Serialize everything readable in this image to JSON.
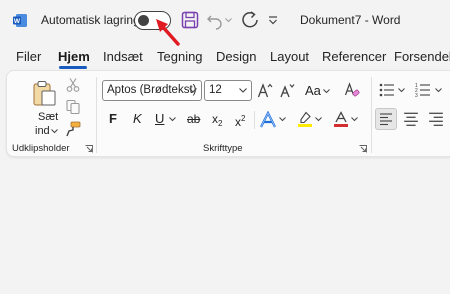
{
  "titlebar": {
    "autosave_label": "Automatisk lagring",
    "document_title": "Dokument7  -  Word"
  },
  "tabs": [
    {
      "label": "Filer"
    },
    {
      "label": "Hjem",
      "active": true
    },
    {
      "label": "Indsæt"
    },
    {
      "label": "Tegning"
    },
    {
      "label": "Design"
    },
    {
      "label": "Layout"
    },
    {
      "label": "Referencer"
    },
    {
      "label": "Forsendels"
    }
  ],
  "clipboard": {
    "paste_label_1": "Sæt",
    "paste_label_2": "ind",
    "group_label": "Udklipsholder"
  },
  "font": {
    "font_name": "Aptos (Brødtekst)",
    "font_size": "12",
    "change_case": "Aa",
    "bold": "F",
    "italic": "K",
    "underline": "U",
    "strikethrough": "ab",
    "subscript": "x",
    "subscript_mark": "2",
    "superscript": "x",
    "superscript_mark": "2",
    "group_label": "Skrifttype"
  },
  "colors": {
    "accent": "#185abd",
    "word_blue": "#185abd",
    "save_purple": "#7a3fb0",
    "highlight_yellow": "#ffeb00",
    "font_color_red": "#d32f2f",
    "annotation_red": "#e11b22"
  }
}
